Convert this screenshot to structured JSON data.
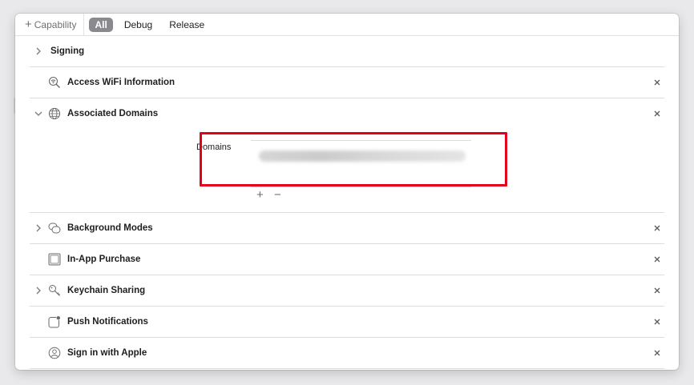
{
  "toolbar": {
    "add_capability": "Capability",
    "tabs": [
      {
        "label": "All",
        "active": true
      },
      {
        "label": "Debug",
        "active": false
      },
      {
        "label": "Release",
        "active": false
      }
    ]
  },
  "capabilities": [
    {
      "title": "Signing",
      "expandable": true,
      "expanded": false,
      "icon": null,
      "removable": false
    },
    {
      "title": "Access WiFi Information",
      "expandable": false,
      "icon": "magnifier-wifi-icon",
      "removable": true
    },
    {
      "title": "Associated Domains",
      "expandable": true,
      "expanded": true,
      "icon": "globe-icon",
      "removable": true
    },
    {
      "title": "Background Modes",
      "expandable": true,
      "expanded": false,
      "icon": "background-modes-icon",
      "removable": true
    },
    {
      "title": "In-App Purchase",
      "expandable": false,
      "icon": "in-app-purchase-icon",
      "removable": true
    },
    {
      "title": "Keychain Sharing",
      "expandable": true,
      "expanded": false,
      "icon": "key-icon",
      "removable": true
    },
    {
      "title": "Push Notifications",
      "expandable": false,
      "icon": "notification-badge-icon",
      "removable": true
    },
    {
      "title": "Sign in with Apple",
      "expandable": false,
      "icon": "person-circle-icon",
      "removable": true
    }
  ],
  "associated_domains": {
    "label": "Domains",
    "value_redacted": true,
    "add_symbol": "+",
    "remove_symbol": "−",
    "highlight_color": "#e3001b"
  },
  "colors": {
    "active_tab_bg": "#8a8a8e",
    "highlight": "#e3001b"
  }
}
